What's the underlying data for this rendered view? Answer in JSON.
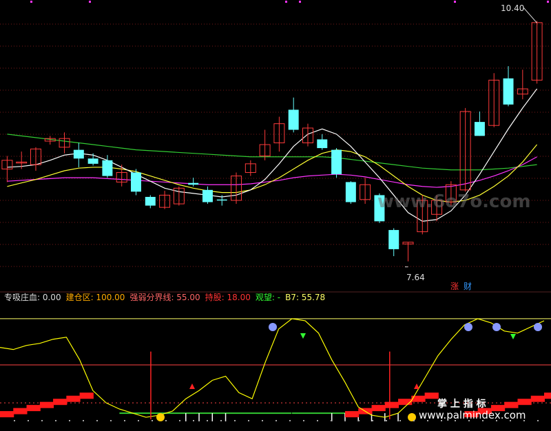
{
  "colors": {
    "bg": "#000000",
    "grid": "#7a1a1a",
    "up": "#ff3b3b",
    "down": "#66ffff",
    "ma_white": "#ffffff",
    "ma_yellow": "#ffff33",
    "ma_magenta": "#ff33ff",
    "ma_green": "#33cc33",
    "osc_yellow": "#ffff00",
    "label_white": "#dddddd",
    "label_orange": "#ffaa00",
    "label_red": "#ff3333",
    "label_green": "#33ff33",
    "label_magenta": "#ff88ff"
  },
  "header": {
    "items": [
      {
        "text": "专吸庄血: 0.00",
        "color": "#dddddd"
      },
      {
        "text": "建仓区: 100.00",
        "color": "#ffaa00"
      },
      {
        "text": "强弱分界线: 55.00",
        "color": "#ff6666"
      },
      {
        "text": "持股: 18.00",
        "color": "#ff3333"
      },
      {
        "text": "观望: -",
        "color": "#33ff33"
      },
      {
        "text": "B7: 55.78",
        "color": "#ffff66"
      }
    ]
  },
  "price_labels": {
    "high": "10.40",
    "low": "7.64"
  },
  "tags": {
    "zhang": "涨",
    "cai": "财"
  },
  "watermarks": {
    "top": "www.6o7o.com",
    "bottom_cn": "掌 上 指 标",
    "bottom_url": "www.palmindex.com"
  },
  "chart_data": [
    {
      "type": "candlestick",
      "ylim": [
        7.4,
        10.6
      ],
      "candles": [
        {
          "o": 8.7,
          "h": 8.85,
          "l": 8.55,
          "c": 8.8
        },
        {
          "o": 8.78,
          "h": 8.9,
          "l": 8.7,
          "c": 8.78
        },
        {
          "o": 8.75,
          "h": 8.95,
          "l": 8.68,
          "c": 8.93
        },
        {
          "o": 9.02,
          "h": 9.08,
          "l": 8.98,
          "c": 9.05
        },
        {
          "o": 8.95,
          "h": 9.12,
          "l": 8.88,
          "c": 9.05
        },
        {
          "o": 8.92,
          "h": 9.0,
          "l": 8.72,
          "c": 8.82
        },
        {
          "o": 8.82,
          "h": 8.88,
          "l": 8.74,
          "c": 8.76
        },
        {
          "o": 8.8,
          "h": 8.86,
          "l": 8.6,
          "c": 8.62
        },
        {
          "o": 8.55,
          "h": 8.75,
          "l": 8.5,
          "c": 8.66
        },
        {
          "o": 8.66,
          "h": 8.7,
          "l": 8.4,
          "c": 8.44
        },
        {
          "o": 8.38,
          "h": 8.4,
          "l": 8.25,
          "c": 8.28
        },
        {
          "o": 8.26,
          "h": 8.45,
          "l": 8.24,
          "c": 8.4
        },
        {
          "o": 8.3,
          "h": 8.5,
          "l": 8.28,
          "c": 8.48
        },
        {
          "o": 8.54,
          "h": 8.6,
          "l": 8.5,
          "c": 8.52
        },
        {
          "o": 8.46,
          "h": 8.5,
          "l": 8.3,
          "c": 8.32
        },
        {
          "o": 8.35,
          "h": 8.4,
          "l": 8.28,
          "c": 8.34
        },
        {
          "o": 8.34,
          "h": 8.66,
          "l": 8.3,
          "c": 8.62
        },
        {
          "o": 8.66,
          "h": 8.8,
          "l": 8.62,
          "c": 8.76
        },
        {
          "o": 8.85,
          "h": 9.15,
          "l": 8.8,
          "c": 8.98
        },
        {
          "o": 9.0,
          "h": 9.3,
          "l": 8.9,
          "c": 9.22
        },
        {
          "o": 9.38,
          "h": 9.52,
          "l": 9.12,
          "c": 9.15
        },
        {
          "o": 9.0,
          "h": 9.22,
          "l": 8.96,
          "c": 9.17
        },
        {
          "o": 9.04,
          "h": 9.1,
          "l": 8.92,
          "c": 8.94
        },
        {
          "o": 8.92,
          "h": 8.94,
          "l": 8.6,
          "c": 8.64
        },
        {
          "o": 8.55,
          "h": 8.56,
          "l": 8.3,
          "c": 8.32
        },
        {
          "o": 8.35,
          "h": 8.6,
          "l": 8.3,
          "c": 8.52
        },
        {
          "o": 8.4,
          "h": 8.42,
          "l": 8.08,
          "c": 8.1
        },
        {
          "o": 8.0,
          "h": 8.02,
          "l": 7.7,
          "c": 7.78
        },
        {
          "o": 7.84,
          "h": 7.86,
          "l": 7.64,
          "c": 7.86
        },
        {
          "o": 7.98,
          "h": 8.4,
          "l": 7.95,
          "c": 8.34
        },
        {
          "o": 8.18,
          "h": 8.4,
          "l": 8.1,
          "c": 8.34
        },
        {
          "o": 8.32,
          "h": 8.56,
          "l": 8.28,
          "c": 8.52
        },
        {
          "o": 8.46,
          "h": 9.4,
          "l": 8.44,
          "c": 9.36
        },
        {
          "o": 9.24,
          "h": 9.36,
          "l": 9.08,
          "c": 9.08
        },
        {
          "o": 9.2,
          "h": 9.8,
          "l": 9.18,
          "c": 9.72
        },
        {
          "o": 9.74,
          "h": 9.88,
          "l": 9.42,
          "c": 9.44
        },
        {
          "o": 9.56,
          "h": 9.84,
          "l": 9.5,
          "c": 9.62
        },
        {
          "o": 9.72,
          "h": 10.4,
          "l": 9.68,
          "c": 10.38
        }
      ],
      "ma_white": [
        8.72,
        8.73,
        8.75,
        8.8,
        8.86,
        8.88,
        8.86,
        8.8,
        8.72,
        8.64,
        8.56,
        8.48,
        8.44,
        8.42,
        8.4,
        8.38,
        8.4,
        8.46,
        8.58,
        8.76,
        8.96,
        9.1,
        9.16,
        9.1,
        8.96,
        8.78,
        8.6,
        8.4,
        8.2,
        8.1,
        8.12,
        8.22,
        8.4,
        8.64,
        8.9,
        9.16,
        9.4,
        9.62
      ],
      "ma_yellow": [
        8.5,
        8.54,
        8.58,
        8.63,
        8.68,
        8.71,
        8.72,
        8.72,
        8.7,
        8.67,
        8.62,
        8.57,
        8.52,
        8.48,
        8.45,
        8.43,
        8.43,
        8.46,
        8.52,
        8.6,
        8.7,
        8.8,
        8.88,
        8.92,
        8.9,
        8.84,
        8.74,
        8.62,
        8.5,
        8.4,
        8.34,
        8.32,
        8.34,
        8.4,
        8.5,
        8.62,
        8.78,
        8.98
      ],
      "ma_magenta": [
        8.56,
        8.57,
        8.58,
        8.59,
        8.6,
        8.6,
        8.6,
        8.59,
        8.58,
        8.57,
        8.56,
        8.55,
        8.54,
        8.53,
        8.52,
        8.52,
        8.52,
        8.53,
        8.55,
        8.57,
        8.6,
        8.62,
        8.63,
        8.64,
        8.63,
        8.61,
        8.58,
        8.55,
        8.52,
        8.5,
        8.49,
        8.5,
        8.53,
        8.57,
        8.62,
        8.68,
        8.75,
        8.84
      ],
      "ma_green": [
        9.1,
        9.08,
        9.06,
        9.04,
        9.02,
        9.0,
        8.98,
        8.96,
        8.94,
        8.92,
        8.91,
        8.9,
        8.89,
        8.88,
        8.87,
        8.86,
        8.85,
        8.84,
        8.84,
        8.84,
        8.84,
        8.84,
        8.84,
        8.83,
        8.81,
        8.79,
        8.77,
        8.75,
        8.73,
        8.71,
        8.7,
        8.69,
        8.69,
        8.69,
        8.7,
        8.71,
        8.73,
        8.75
      ]
    },
    {
      "type": "line",
      "ylim": [
        0,
        110
      ],
      "series": [
        {
          "values": [
            72,
            70,
            74,
            76,
            80,
            82,
            60,
            30,
            18,
            12,
            8,
            4,
            6,
            10,
            22,
            30,
            40,
            44,
            28,
            22,
            58,
            90,
            100,
            98,
            86,
            60,
            38,
            14,
            6,
            4,
            8,
            20,
            42,
            64,
            80,
            94,
            100,
            96,
            88,
            86,
            92,
            98
          ]
        }
      ],
      "reference_lines": [
        100,
        55,
        18
      ],
      "step_bars": [
        {
          "start": 0,
          "end": 6,
          "levels": [
            2,
            3,
            4,
            5,
            6,
            7,
            8
          ]
        },
        {
          "start": 26,
          "end": 32,
          "levels": [
            2,
            3,
            4,
            5,
            6,
            7,
            8
          ]
        },
        {
          "start": 35,
          "end": 41,
          "levels": [
            2,
            3,
            4,
            5,
            6,
            7,
            8
          ]
        }
      ],
      "green_zones": [
        [
          9,
          23
        ],
        [
          22,
          28
        ]
      ],
      "white_ticks": [
        14,
        15,
        16,
        17,
        25,
        26,
        27,
        28,
        29,
        30
      ]
    }
  ]
}
